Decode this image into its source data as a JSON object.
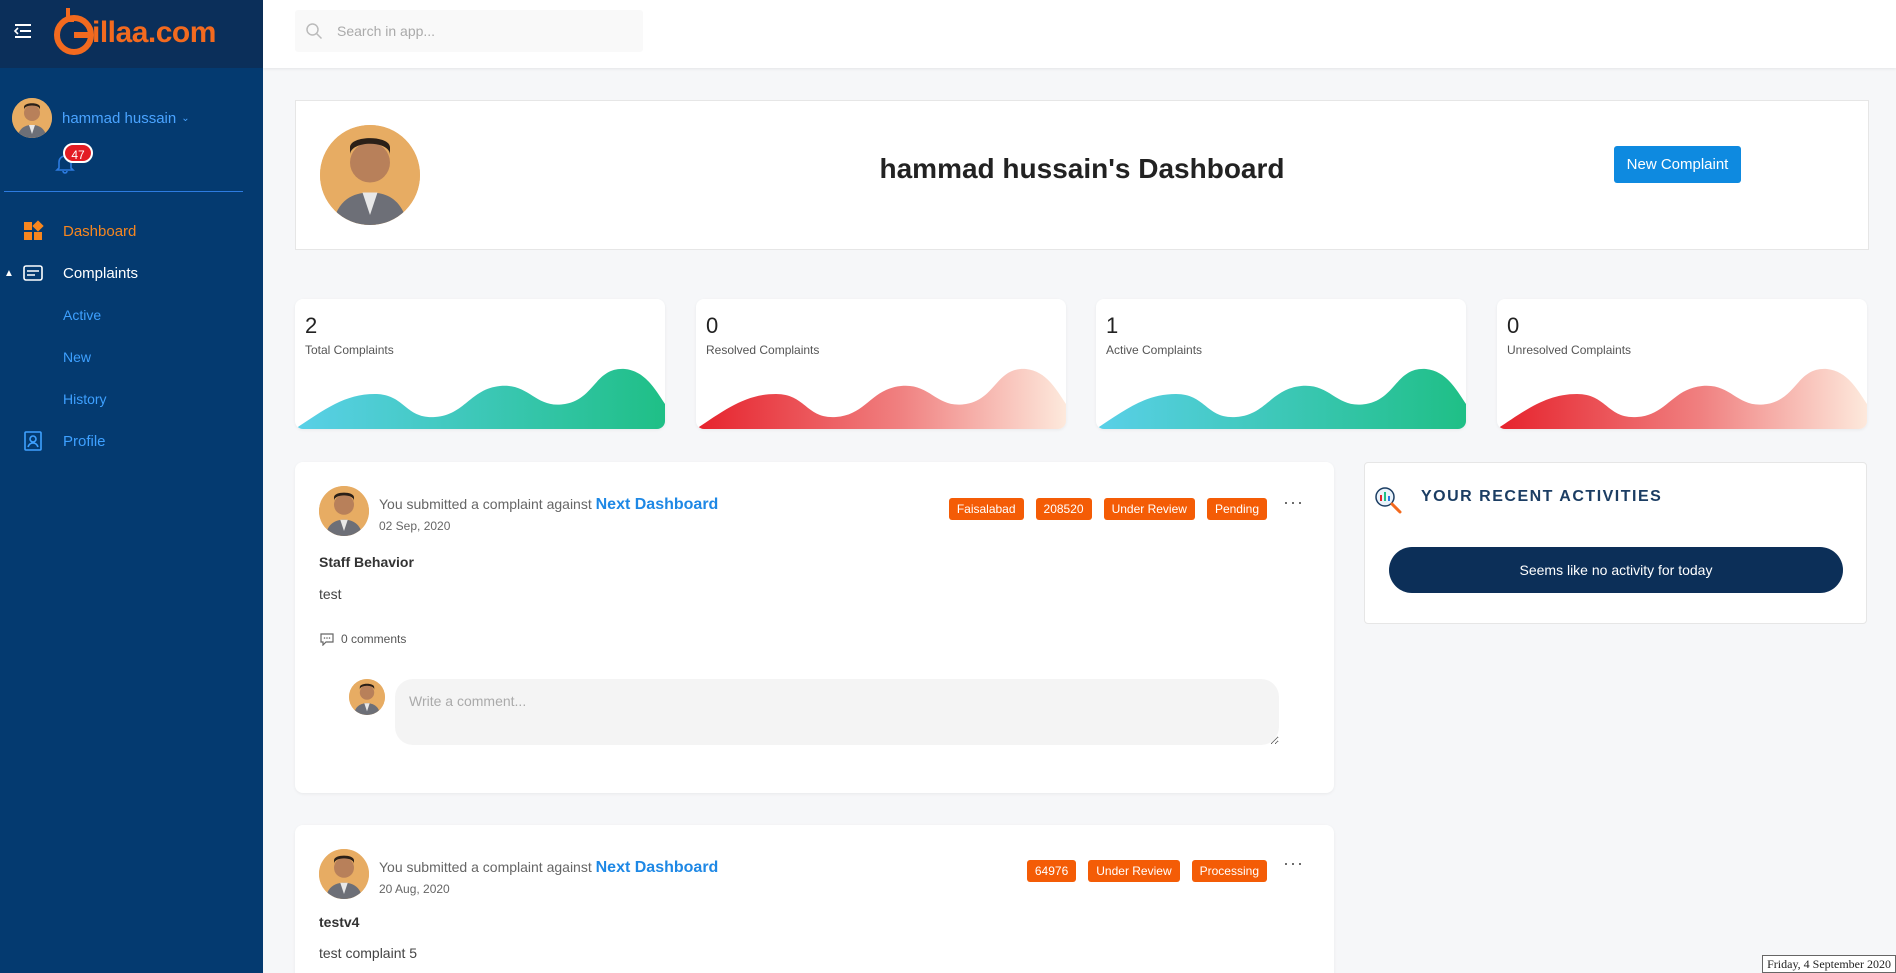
{
  "brand": {
    "logo_text": "illaa.com",
    "accent": "#f36a1f"
  },
  "user": {
    "name": "hammad hussain",
    "notifications": "47"
  },
  "search": {
    "placeholder": "Search in app..."
  },
  "nav": {
    "dashboard": "Dashboard",
    "complaints": "Complaints",
    "active": "Active",
    "new": "New",
    "history": "History",
    "profile": "Profile"
  },
  "header": {
    "title": "hammad hussain's Dashboard",
    "new_complaint": "New Complaint"
  },
  "stats": [
    {
      "value": "2",
      "label": "Total Complaints",
      "theme": "teal"
    },
    {
      "value": "0",
      "label": "Resolved Complaints",
      "theme": "red"
    },
    {
      "value": "1",
      "label": "Active Complaints",
      "theme": "teal"
    },
    {
      "value": "0",
      "label": "Unresolved Complaints",
      "theme": "red"
    }
  ],
  "complaints": [
    {
      "prefix": "You submitted a complaint against",
      "target": "Next Dashboard",
      "date": "02 Sep, 2020",
      "tags": [
        "Faisalabad",
        "208520",
        "Under Review",
        "Pending"
      ],
      "subject": "Staff Behavior",
      "body": "test",
      "comments": "0 comments",
      "comment_placeholder": "Write a comment..."
    },
    {
      "prefix": "You submitted a complaint against",
      "target": "Next Dashboard",
      "date": "20 Aug, 2020",
      "tags": [
        "64976",
        "Under Review",
        "Processing"
      ],
      "subject": "testv4",
      "body": "test complaint 5"
    }
  ],
  "activities": {
    "title": "YOUR RECENT ACTIVITIES",
    "empty": "Seems like no activity for today"
  },
  "footer": {
    "date": "Friday, 4 September 2020"
  }
}
